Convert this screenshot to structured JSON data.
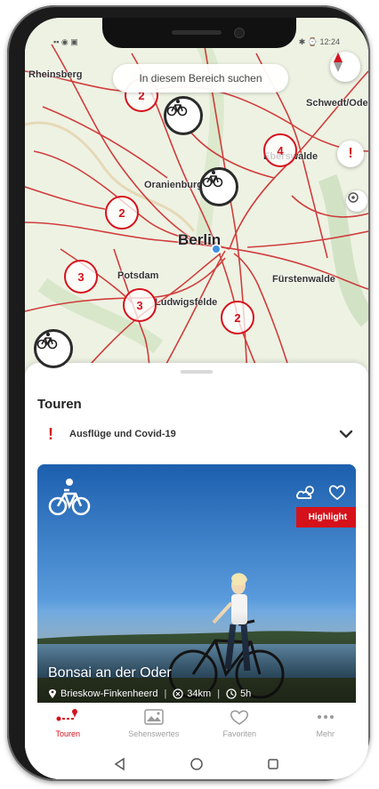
{
  "status_bar": {
    "left": "▪▪ ◉ ▣",
    "right": "✱ ⌚ 12:24"
  },
  "map": {
    "search_label": "In diesem Bereich suchen",
    "cities": [
      {
        "label": "Berlin",
        "big": true
      },
      {
        "label": "Potsdam",
        "big": false
      },
      {
        "label": "Oranienburg",
        "big": false
      },
      {
        "label": "Eberswalde",
        "big": false
      },
      {
        "label": "Fürstenwalde",
        "big": false
      },
      {
        "label": "Ludwigsfelde",
        "big": false
      },
      {
        "label": "Schwedt/Oder",
        "big": false
      },
      {
        "label": "Rheinsberg",
        "big": false
      }
    ],
    "clusters": [
      "2",
      "4",
      "3",
      "3",
      "2",
      "2"
    ],
    "compass_icon": "compass-icon",
    "colors": {
      "accent": "#d5121c",
      "route": "#cc2b2b"
    }
  },
  "sheet": {
    "title": "Touren",
    "notice": {
      "text": "Ausflüge und Covid-19",
      "icon": "exclamation-icon"
    }
  },
  "card": {
    "badge": "Highlight",
    "title": "Bonsai an der Oder",
    "location": "Brieskow-Finkenheerd",
    "distance": "34km",
    "duration": "5h"
  },
  "tabs": [
    {
      "label": "Touren",
      "icon": "route-icon",
      "active": true
    },
    {
      "label": "Sehenswertes",
      "icon": "landscape-icon",
      "active": false
    },
    {
      "label": "Favoriten",
      "icon": "heart-icon",
      "active": false
    },
    {
      "label": "Mehr",
      "icon": "more-icon",
      "active": false
    }
  ]
}
